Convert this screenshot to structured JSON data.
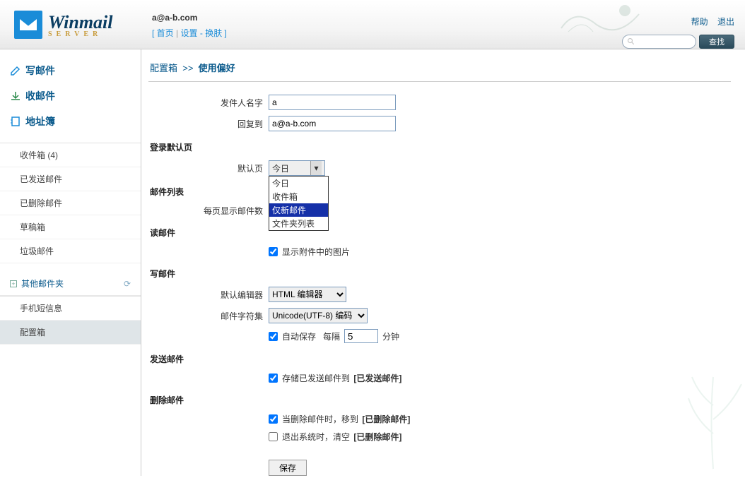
{
  "header": {
    "logo_main": "Winmail",
    "logo_sub": "SERVER",
    "email": "a@a-b.com",
    "nav_home": "首页",
    "nav_settings": "设置",
    "nav_theme": "换肤",
    "link_help": "帮助",
    "link_logout": "退出",
    "search_btn": "查找"
  },
  "sidebar": {
    "compose": "写邮件",
    "receive": "收邮件",
    "addressbook": "地址簿",
    "folders": {
      "inbox": "收件箱 (4)",
      "sent": "已发送邮件",
      "trash": "已删除邮件",
      "drafts": "草稿箱",
      "junk": "垃圾邮件"
    },
    "other_header": "其他邮件夹",
    "sms": "手机短信息",
    "config": "配置箱"
  },
  "breadcrumb": {
    "root": "配置箱",
    "sep": ">>",
    "current": "使用偏好"
  },
  "form": {
    "sender_name_label": "发件人名字",
    "sender_name_value": "a",
    "reply_to_label": "回复到",
    "reply_to_value": "a@a-b.com",
    "section_login": "登录默认页",
    "default_page_label": "默认页",
    "default_page_value": "今日",
    "default_page_options": [
      "今日",
      "收件箱",
      "仅新邮件",
      "文件夹列表"
    ],
    "section_list": "邮件列表",
    "per_page_label": "每页显示邮件数",
    "section_read": "读邮件",
    "show_images_label": "显示附件中的图片",
    "section_compose": "写邮件",
    "editor_label": "默认编辑器",
    "editor_value": "HTML 编辑器",
    "charset_label": "邮件字符集",
    "charset_value": "Unicode(UTF-8) 编码",
    "autosave_prefix": "自动保存",
    "autosave_mid": "每隔",
    "autosave_value": "5",
    "autosave_suffix": "分钟",
    "section_send": "发送邮件",
    "save_sent_prefix": "存储已发送邮件到",
    "save_sent_folder": "[已发送邮件]",
    "section_delete": "删除邮件",
    "move_delete_prefix": "当删除邮件时，移到",
    "move_delete_folder": "[已删除邮件]",
    "logout_clear_prefix": "退出系统时，清空",
    "logout_clear_folder": "[已删除邮件]",
    "save_btn": "保存"
  }
}
